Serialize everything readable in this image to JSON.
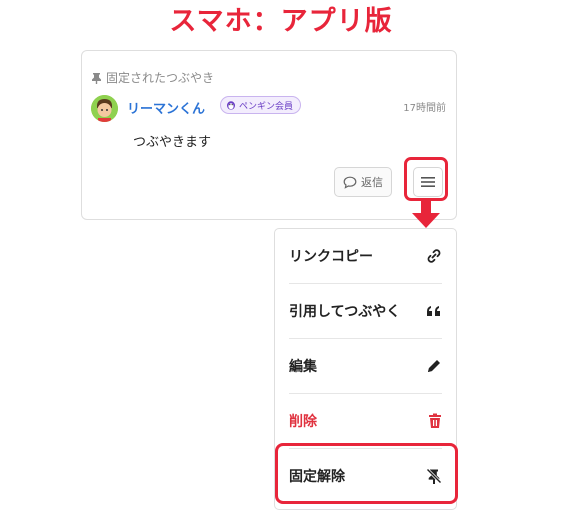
{
  "header": {
    "title": "スマホ：アプリ版"
  },
  "post": {
    "pinned_label": "固定されたつぶやき",
    "username": "リーマンくん",
    "badge": "ペンギン会員",
    "time": "17時間前",
    "text": "つぶやきます",
    "reply_label": "返信"
  },
  "menu": {
    "items": [
      {
        "label": "リンクコピー",
        "icon": "link-icon"
      },
      {
        "label": "引用してつぶやく",
        "icon": "quote-icon"
      },
      {
        "label": "編集",
        "icon": "pencil-icon"
      },
      {
        "label": "削除",
        "icon": "trash-icon"
      },
      {
        "label": "固定解除",
        "icon": "unpin-icon"
      }
    ]
  },
  "colors": {
    "accent": "#e8253a",
    "username": "#2b73d6",
    "danger": "#e0323f"
  }
}
